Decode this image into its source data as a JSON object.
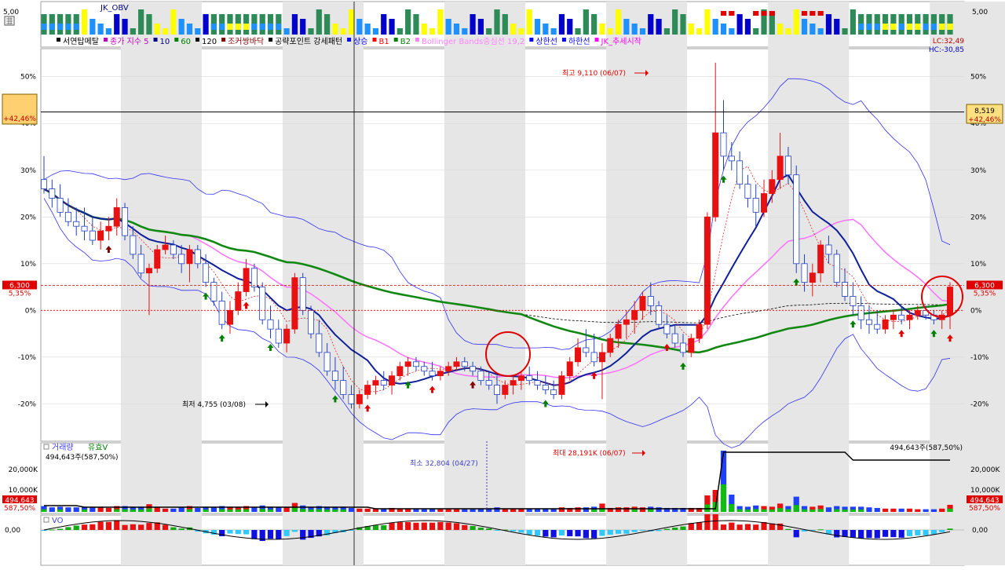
{
  "obv_panel": {
    "title": "JK_OBV",
    "scale_left": "5,00",
    "scale_right": "5,00"
  },
  "main_legend": [
    {
      "text": "서연탑메탈",
      "color": "#000000"
    },
    {
      "text": "종가 지수 5",
      "color": "#c000c0"
    },
    {
      "text": "10",
      "color": "#000080"
    },
    {
      "text": "60",
      "color": "#008000"
    },
    {
      "text": "120",
      "color": "#000000"
    },
    {
      "text": "조커쌍바닥",
      "color": "#800000"
    },
    {
      "text": "공략포인트 강세패턴",
      "color": "#000000"
    },
    {
      "text": "상승",
      "color": "#0000ff"
    },
    {
      "text": "B1",
      "color": "#ff0000"
    },
    {
      "text": "B2",
      "color": "#008000"
    },
    {
      "text": "Bollinger Bands중심선 19,2",
      "color": "#ff80ff"
    },
    {
      "text": "상한선",
      "color": "#0000ff"
    },
    {
      "text": "하한선",
      "color": "#0000ff"
    },
    {
      "text": "JK_추세시작",
      "color": "#ff00ff"
    }
  ],
  "right_info": {
    "lc": "LC:32,49",
    "hc": "HC:-30,85"
  },
  "left_badge": {
    "pct": "+42,46%"
  },
  "right_badge": {
    "price": "8,519",
    "pct": "+42,46%"
  },
  "current_price": {
    "price": "6,300",
    "pct": "5,35%"
  },
  "annotations": {
    "high": "최고 9,110 (06/07)",
    "low": "최저 4,755 (03/08)",
    "vol_min": "최소 32,804 (04/27)",
    "vol_max": "최대 28,191K (06/07)",
    "vol_current": "494,643주(587,50%)"
  },
  "volume_panel": {
    "title_a": "거래량",
    "title_b": "유효V",
    "left_label": "494,643주(587,50%)",
    "badge_value": "494,643",
    "badge_pct": "587,50%",
    "ticks": [
      "20,000K",
      "10,000K"
    ]
  },
  "vo_panel": {
    "title": "VO",
    "zero": "0,00"
  },
  "chart_data": {
    "type": "candlestick",
    "y_unit": "% change from reference price",
    "y_ticks": [
      "50%",
      "40%",
      "30%",
      "20%",
      "10%",
      "0%",
      "-10%",
      "-20%"
    ],
    "ylim": [
      -28,
      56
    ],
    "reference_lines": [
      {
        "label": "6,300",
        "y": 5.35
      },
      {
        "y": 0
      }
    ],
    "horizontal_marker": {
      "label": "8,519",
      "y": 42.46
    },
    "candles_ohlc": [
      [
        28,
        33,
        25,
        26
      ],
      [
        26,
        28,
        22,
        24
      ],
      [
        24,
        27,
        20,
        21
      ],
      [
        21,
        24,
        18,
        19
      ],
      [
        19,
        22,
        16,
        18
      ],
      [
        18,
        22,
        15,
        17
      ],
      [
        17,
        20,
        14,
        15
      ],
      [
        15,
        19,
        13,
        17
      ],
      [
        17,
        20,
        15,
        18
      ],
      [
        18,
        24,
        16,
        22
      ],
      [
        22,
        23,
        15,
        16
      ],
      [
        16,
        18,
        11,
        12
      ],
      [
        12,
        14,
        7,
        8
      ],
      [
        8,
        10,
        -1,
        9
      ],
      [
        9,
        14,
        8,
        13
      ],
      [
        13,
        16,
        12,
        14
      ],
      [
        14,
        15,
        11,
        12
      ],
      [
        12,
        14,
        8,
        10
      ],
      [
        10,
        14,
        6,
        13
      ],
      [
        13,
        14,
        9,
        10
      ],
      [
        10,
        12,
        5,
        6
      ],
      [
        6,
        7,
        1,
        2
      ],
      [
        2,
        4,
        -4,
        -3
      ],
      [
        -3,
        2,
        -5,
        0
      ],
      [
        0,
        6,
        -1,
        4
      ],
      [
        4,
        11,
        3,
        9
      ],
      [
        9,
        10,
        4,
        5
      ],
      [
        5,
        6,
        -3,
        -2
      ],
      [
        -2,
        1,
        -6,
        -4
      ],
      [
        -4,
        -2,
        -8,
        -7
      ],
      [
        -7,
        -3,
        -9,
        -4
      ],
      [
        -4,
        8,
        -5,
        7
      ],
      [
        7,
        8,
        -1,
        0
      ],
      [
        0,
        1,
        -6,
        -5
      ],
      [
        -5,
        -2,
        -10,
        -9
      ],
      [
        -9,
        -7,
        -14,
        -13
      ],
      [
        -13,
        -10,
        -17,
        -15
      ],
      [
        -15,
        -12,
        -19,
        -18
      ],
      [
        -18,
        -16,
        -21,
        -20
      ],
      [
        -20,
        -17,
        -21,
        -18
      ],
      [
        -18,
        -15,
        -19,
        -16
      ],
      [
        -16,
        -14,
        -18,
        -15
      ],
      [
        -15,
        -13,
        -17,
        -16
      ],
      [
        -16,
        -13,
        -18,
        -14
      ],
      [
        -14,
        -11,
        -15,
        -12
      ],
      [
        -12,
        -10,
        -14,
        -11
      ],
      [
        -11,
        -10,
        -13,
        -12
      ],
      [
        -12,
        -11,
        -14,
        -13
      ],
      [
        -13,
        -11,
        -15,
        -14
      ],
      [
        -14,
        -12,
        -15,
        -13
      ],
      [
        -13,
        -11,
        -14,
        -12
      ],
      [
        -12,
        -10,
        -13,
        -11
      ],
      [
        -11,
        -10,
        -13,
        -12
      ],
      [
        -12,
        -11,
        -14,
        -13
      ],
      [
        -13,
        -12,
        -16,
        -15
      ],
      [
        -15,
        -13,
        -17,
        -16
      ],
      [
        -16,
        -14,
        -20,
        -18
      ],
      [
        -18,
        -15,
        -19,
        -16
      ],
      [
        -16,
        -14,
        -18,
        -15
      ],
      [
        -15,
        -13,
        -17,
        -14
      ],
      [
        -14,
        -12,
        -16,
        -15
      ],
      [
        -15,
        -13,
        -17,
        -16
      ],
      [
        -16,
        -14,
        -18,
        -17
      ],
      [
        -17,
        -15,
        -19,
        -18
      ],
      [
        -18,
        -13,
        -19,
        -14
      ],
      [
        -14,
        -10,
        -15,
        -11
      ],
      [
        -11,
        -6,
        -12,
        -8
      ],
      [
        -8,
        -4,
        -10,
        -9
      ],
      [
        -9,
        -5,
        -12,
        -11
      ],
      [
        -11,
        -7,
        -19,
        -9
      ],
      [
        -9,
        -5,
        -10,
        -6
      ],
      [
        -6,
        -2,
        -8,
        -3
      ],
      [
        -3,
        0,
        -6,
        -2
      ],
      [
        -2,
        2,
        -5,
        0
      ],
      [
        0,
        4,
        -2,
        3
      ],
      [
        3,
        6,
        -1,
        1
      ],
      [
        1,
        2,
        -4,
        -3
      ],
      [
        -3,
        -1,
        -6,
        -5
      ],
      [
        -5,
        -3,
        -8,
        -7
      ],
      [
        -7,
        -5,
        -10,
        -9
      ],
      [
        -9,
        -5,
        -10,
        -6
      ],
      [
        -6,
        -2,
        -7,
        -3
      ],
      [
        -3,
        21,
        -4,
        20
      ],
      [
        20,
        53,
        19,
        38
      ],
      [
        38,
        45,
        30,
        33
      ],
      [
        33,
        36,
        30,
        32
      ],
      [
        32,
        34,
        26,
        27
      ],
      [
        27,
        29,
        22,
        24
      ],
      [
        24,
        27,
        18,
        21
      ],
      [
        21,
        28,
        20,
        25
      ],
      [
        25,
        30,
        23,
        28
      ],
      [
        28,
        38,
        26,
        33
      ],
      [
        33,
        35,
        27,
        29
      ],
      [
        29,
        31,
        8,
        10
      ],
      [
        10,
        12,
        4,
        6
      ],
      [
        6,
        10,
        3,
        8
      ],
      [
        8,
        15,
        6,
        14
      ],
      [
        14,
        16,
        10,
        12
      ],
      [
        12,
        13,
        5,
        6
      ],
      [
        6,
        9,
        2,
        3
      ],
      [
        3,
        6,
        -1,
        1
      ],
      [
        1,
        3,
        -4,
        -2
      ],
      [
        -2,
        1,
        -5,
        -3
      ],
      [
        -3,
        0,
        -5,
        -4
      ],
      [
        -4,
        -1,
        -5,
        -2
      ],
      [
        -2,
        0,
        -4,
        -1
      ],
      [
        -1,
        1,
        -3,
        -2
      ],
      [
        -2,
        0,
        -4,
        -1
      ],
      [
        -1,
        1,
        -2,
        0
      ],
      [
        0,
        1,
        -2,
        -1
      ],
      [
        -1,
        0,
        -3,
        -2
      ],
      [
        -2,
        0,
        -4,
        -1
      ],
      [
        -1,
        6,
        -4,
        5
      ]
    ]
  }
}
